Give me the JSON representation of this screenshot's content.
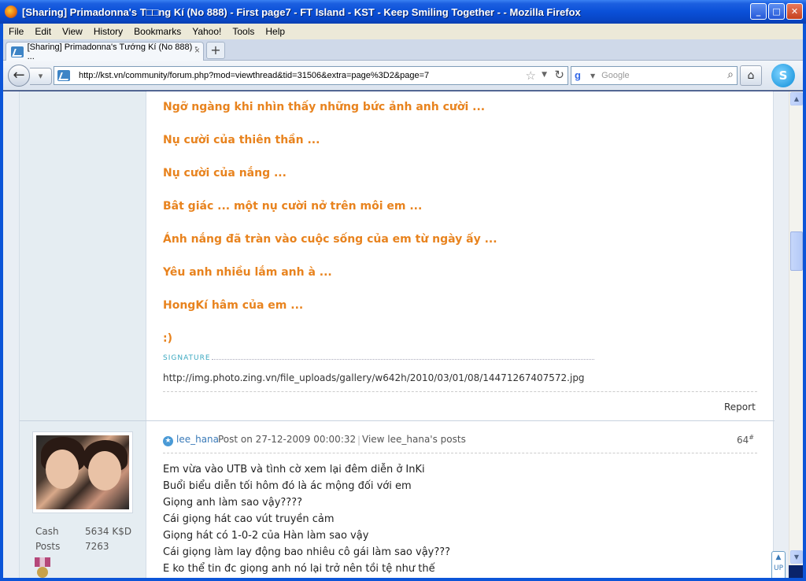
{
  "window": {
    "title": "[Sharing] Primadonna's T□□ng Kí (No 888) - First page7 - FT Island - KST - Keep Smiling Together - - Mozilla Firefox",
    "minimize": "_",
    "maximize": "□",
    "close": "✕"
  },
  "menu": [
    "File",
    "Edit",
    "View",
    "History",
    "Bookmarks",
    "Yahoo!",
    "Tools",
    "Help"
  ],
  "tab": {
    "label": "[Sharing] Primadonna's Tướng Kí (No 888) - ...",
    "close": "×",
    "new_tab": "+"
  },
  "nav": {
    "url": "http://kst.vn/community/forum.php?mod=viewthread&tid=31506&extra=page%3D2&page=7",
    "search_placeholder": "Google",
    "search_engine_icon": "google-icon"
  },
  "post1": {
    "lines": [
      "Ngỡ ngàng khi nhìn thấy những bức ảnh anh cười ...",
      "Nụ cười của thiên thần ...",
      "Nụ cười của nắng ...",
      "Bât giác ... một nụ cười nở trên môi em ...",
      "Ánh nắng đã tràn vào cuộc sống của em từ ngày ấy ...",
      "Yêu anh nhiều lắm anh à ...",
      "HongKí hâm của em ...",
      ":)"
    ],
    "signature_label": "SIGNATURE",
    "signature_text": "http://img.photo.zing.vn/file_uploads/gallery/w642h/2010/03/01/08/14471267407572.jpg",
    "report": "Report"
  },
  "post2": {
    "username": "lee_hana",
    "posted": "Post on 27-12-2009 00:00:32",
    "separator": "|",
    "view_posts": "View lee_hana's posts",
    "number": "64",
    "number_suffix": "#",
    "stats": [
      {
        "label": "Cash",
        "value": "5634 K$D"
      },
      {
        "label": "Posts",
        "value": "7263"
      }
    ],
    "lines": [
      "Em vừa vào UTB và tình cờ xem lại đêm diễn ở InKi",
      "Buổi biểu diễn tối hôm đó là ác mộng đối với em",
      "Giọng anh làm sao vậy????",
      "Cái giọng hát cao vút truyền cảm",
      "Giọng hát có 1-0-2 của Hàn làm sao vậy",
      "Cái giọng làm lay động bao nhiêu cô gái làm sao vậy???",
      "E ko thể tin đc giọng anh nó lại trở nên tồi tệ như thế"
    ]
  },
  "side_button": "UP",
  "scroll": {
    "position": 0.31
  }
}
